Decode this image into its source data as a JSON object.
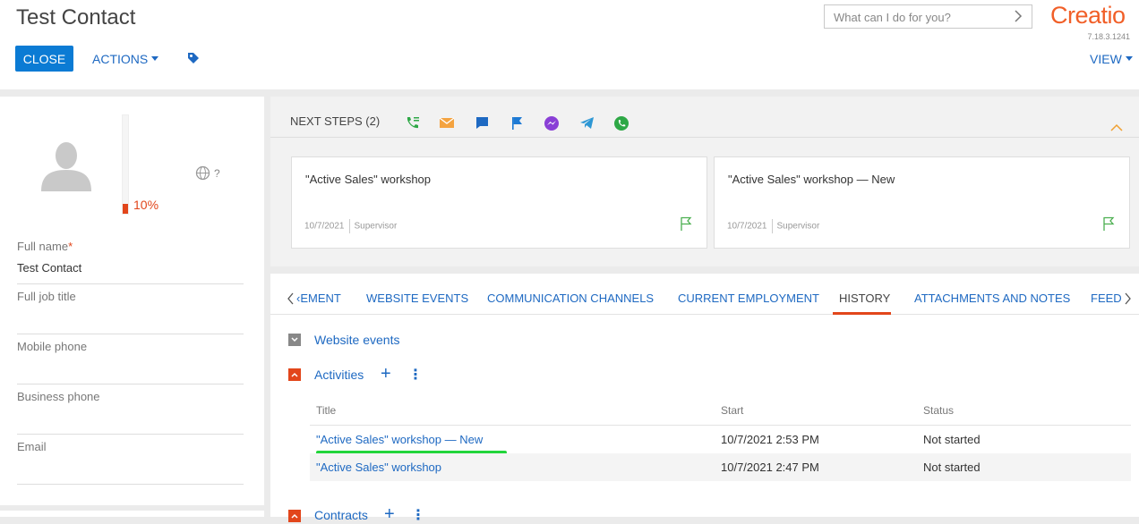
{
  "header": {
    "title": "Test Contact",
    "close_label": "CLOSE",
    "actions_label": "ACTIONS",
    "view_label": "VIEW",
    "search_placeholder": "What can I do for you?",
    "logo_text": "Creatio",
    "version": "7.18.3.1241"
  },
  "profile": {
    "completeness": "10%",
    "completeness_value": 0.1,
    "timezone_hint": "?",
    "fields": [
      {
        "label": "Full name",
        "required": true,
        "value": "Test Contact"
      },
      {
        "label": "Full job title",
        "required": false,
        "value": ""
      },
      {
        "label": "Mobile phone",
        "required": false,
        "value": ""
      },
      {
        "label": "Business phone",
        "required": false,
        "value": ""
      },
      {
        "label": "Email",
        "required": false,
        "value": ""
      }
    ]
  },
  "next_steps": {
    "title": "NEXT STEPS (2)",
    "icons": [
      "call-icon",
      "email-icon",
      "chat-icon",
      "flag-icon",
      "messenger-icon",
      "telegram-icon",
      "whatsapp-icon"
    ],
    "cards": [
      {
        "title": "\"Active Sales\" workshop",
        "date": "10/7/2021",
        "owner": "Supervisor"
      },
      {
        "title": "\"Active Sales\" workshop — New",
        "date": "10/7/2021",
        "owner": "Supervisor"
      }
    ]
  },
  "tabs": {
    "items": [
      "‹EMENT",
      "WEBSITE EVENTS",
      "COMMUNICATION CHANNELS",
      "CURRENT EMPLOYMENT",
      "HISTORY",
      "ATTACHMENTS AND NOTES",
      "FEED"
    ],
    "first_visible": "‹EMENT",
    "active": "HISTORY"
  },
  "history": {
    "sections": [
      {
        "title": "Website events",
        "expanded": false
      },
      {
        "title": "Activities",
        "expanded": true
      },
      {
        "title": "Contracts",
        "expanded": true
      }
    ],
    "activities": {
      "columns": [
        "Title",
        "Start",
        "Status"
      ],
      "rows": [
        {
          "title": "\"Active Sales\" workshop — New",
          "start": "10/7/2021 2:53 PM",
          "status": "Not started"
        },
        {
          "title": "\"Active Sales\" workshop",
          "start": "10/7/2021 2:47 PM",
          "status": "Not started"
        }
      ]
    }
  },
  "colors": {
    "accent_blue": "#1e69c2",
    "primary_button": "#0b7bd4",
    "brand_orange": "#f15f28",
    "highlight_green": "#22d53b"
  }
}
